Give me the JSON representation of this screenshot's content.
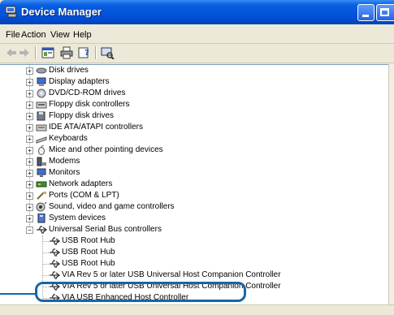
{
  "window": {
    "title": "Device Manager"
  },
  "menu": {
    "file": "File",
    "action": "Action",
    "view": "View",
    "help": "Help"
  },
  "toolbar": {
    "buttons": [
      "back-arrow-icon",
      "forward-arrow-icon",
      "properties-icon",
      "print-icon",
      "help-icon",
      "scan-hardware-icon"
    ]
  },
  "tree": {
    "categories": [
      {
        "label": "Disk drives",
        "icon": "disk-drive-icon"
      },
      {
        "label": "Display adapters",
        "icon": "display-adapter-icon"
      },
      {
        "label": "DVD/CD-ROM drives",
        "icon": "dvd-drive-icon"
      },
      {
        "label": "Floppy disk controllers",
        "icon": "floppy-controller-icon"
      },
      {
        "label": "Floppy disk drives",
        "icon": "floppy-drive-icon"
      },
      {
        "label": "IDE ATA/ATAPI controllers",
        "icon": "ide-controller-icon"
      },
      {
        "label": "Keyboards",
        "icon": "keyboard-icon"
      },
      {
        "label": "Mice and other pointing devices",
        "icon": "mouse-icon"
      },
      {
        "label": "Modems",
        "icon": "modem-icon"
      },
      {
        "label": "Monitors",
        "icon": "monitor-icon"
      },
      {
        "label": "Network adapters",
        "icon": "network-adapter-icon"
      },
      {
        "label": "Ports (COM & LPT)",
        "icon": "port-icon"
      },
      {
        "label": "Sound, video and game controllers",
        "icon": "sound-icon"
      },
      {
        "label": "System devices",
        "icon": "system-device-icon"
      },
      {
        "label": "Universal Serial Bus controllers",
        "icon": "usb-icon",
        "expanded": true
      }
    ],
    "usb_children": [
      "USB Root Hub",
      "USB Root Hub",
      "USB Root Hub",
      "VIA Rev 5 or later USB Universal Host Companion Controller",
      "VIA Rev 5 or later USB Universal Host Companion Controller",
      "VIA USB Enhanced Host Controller"
    ]
  },
  "colors": {
    "titlebar": "#0050d8",
    "callout": "#1666a8"
  }
}
